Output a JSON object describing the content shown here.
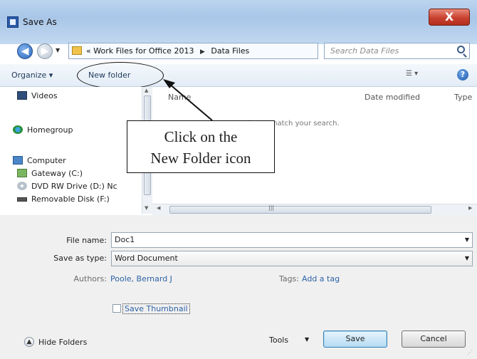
{
  "window": {
    "title": "Save As",
    "close_glyph": "X"
  },
  "nav": {
    "back_glyph": "◀",
    "forward_glyph": "▶",
    "breadcrumb_prefix": "«",
    "crumbs": [
      "Work Files for Office 2013",
      "Data Files"
    ],
    "refresh_glyph": "↻",
    "search_placeholder": "Search Data Files"
  },
  "toolbar": {
    "organize_label": "Organize ▾",
    "new_folder_label": "New folder",
    "help_glyph": "?"
  },
  "sidebar": {
    "items": [
      {
        "label": "Videos",
        "icon": "video-icon"
      },
      {
        "label": "Homegroup",
        "icon": "homegroup-icon"
      },
      {
        "label": "Computer",
        "icon": "computer-icon"
      },
      {
        "label": "Gateway (C:)",
        "icon": "drive-icon"
      },
      {
        "label": "DVD RW Drive (D:) Nc",
        "icon": "dvd-icon"
      },
      {
        "label": "Removable Disk (F:)",
        "icon": "removable-disk-icon"
      }
    ]
  },
  "file_list": {
    "columns": [
      "Name",
      "Date modified",
      "Type"
    ],
    "empty_message": "No items match your search."
  },
  "annotation": {
    "callout_line1": "Click on the",
    "callout_line2": "New Folder icon"
  },
  "form": {
    "file_name_label": "File name:",
    "file_name_value": "Doc1",
    "save_type_label": "Save as type:",
    "save_type_value": "Word Document",
    "authors_label": "Authors:",
    "authors_value": "Poole, Bernard J",
    "tags_label": "Tags:",
    "tags_value": "Add a tag",
    "thumbnail_label": "Save Thumbnail"
  },
  "footer": {
    "hide_folders_label": "Hide Folders",
    "tools_label": "Tools",
    "save_label": "Save",
    "cancel_label": "Cancel"
  },
  "colors": {
    "titlebar": "#a9c6e8",
    "close_button": "#c9412f",
    "link": "#2e63a6"
  }
}
